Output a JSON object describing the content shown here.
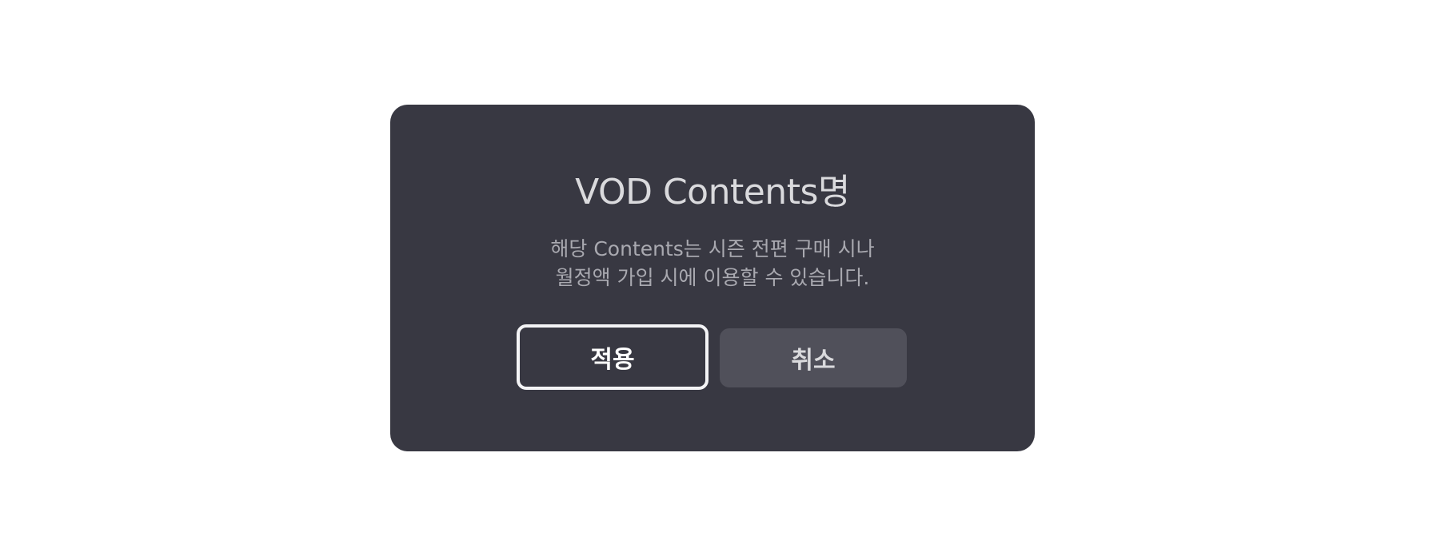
{
  "dialog": {
    "title": "VOD Contents명",
    "message_lines": [
      "해당 Contents는 시즌 전편 구매 시나",
      "월정액 가입 시에 이용할 수 있습니다."
    ],
    "buttons": {
      "apply_label": "적용",
      "cancel_label": "취소"
    }
  },
  "colors": {
    "dialog_background": "#383842",
    "title_text": "#dadadd",
    "message_text": "#a9a9b0",
    "focused_button_border": "#f4f4f6",
    "secondary_button_background": "#50505a"
  }
}
